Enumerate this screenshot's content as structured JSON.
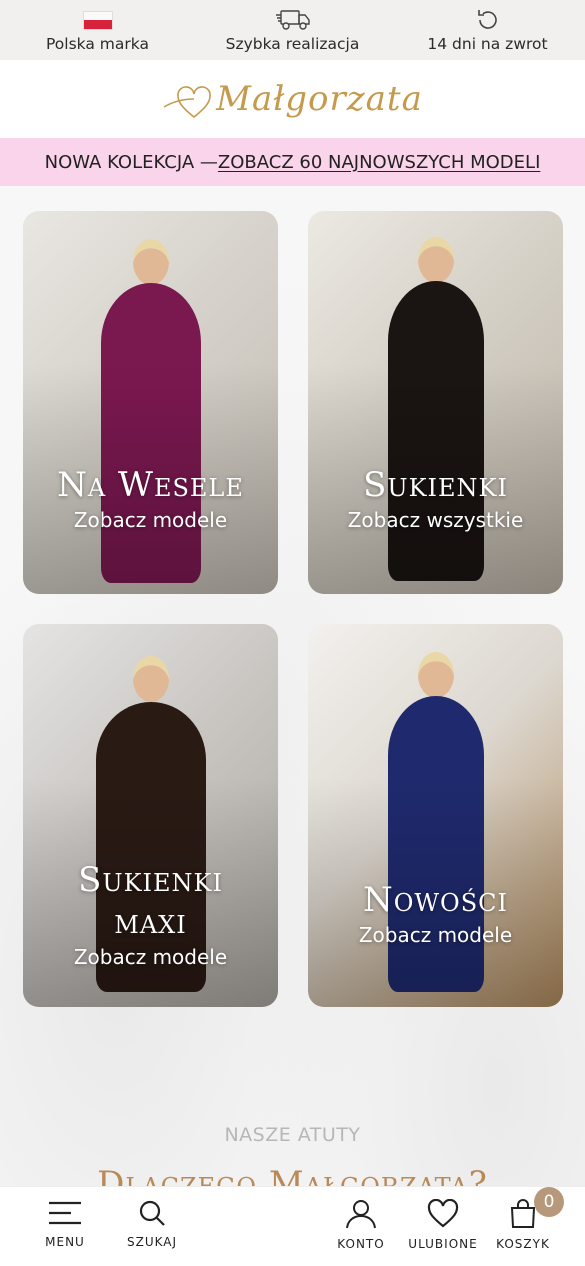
{
  "topbar": {
    "items": [
      {
        "icon": "poland-flag-icon",
        "label": "Polska marka"
      },
      {
        "icon": "delivery-truck-icon",
        "label": "Szybka realizacja"
      },
      {
        "icon": "return-arrow-icon",
        "label": "14 dni na zwrot"
      }
    ]
  },
  "logo": {
    "text": "Małgorzata"
  },
  "promo": {
    "prefix": "NOWA KOLEKCJA — ",
    "link": "ZOBACZ 60 NAJNOWSZYCH MODELI"
  },
  "categories": [
    {
      "title": "Na Wesele",
      "subtitle": "Zobacz modele",
      "dress_color": "#7a1850"
    },
    {
      "title": "Sukienki",
      "subtitle": "Zobacz wszystkie",
      "dress_color": "#1a1412"
    },
    {
      "title_line1": "Sukienki",
      "title_line2": "maxi",
      "subtitle": "Zobacz modele",
      "dress_color": "#2a1a14"
    },
    {
      "title": "Nowości",
      "subtitle": "Zobacz modele",
      "dress_color": "#1f2a6e"
    }
  ],
  "section": {
    "label": "NASZE ATUTY",
    "title": "Dlaczego Małgorzata?"
  },
  "bottom_nav": {
    "menu": "MENU",
    "search": "SZUKAJ",
    "account": "KONTO",
    "favorites": "ULUBIONE",
    "cart": "KOSZYK",
    "cart_count": "0"
  },
  "colors": {
    "promo_bg": "#f9d4ea",
    "logo": "#c59a4c",
    "badge": "#b8987a"
  }
}
